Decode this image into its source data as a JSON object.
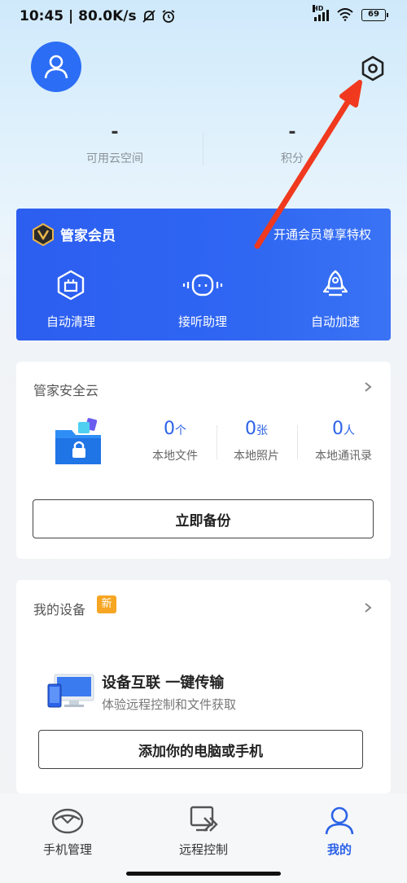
{
  "status_bar": {
    "time_speed": "10:45 | 80.0K/s",
    "network": "HD",
    "battery": "69"
  },
  "header": {
    "stats": [
      {
        "value": "-",
        "label": "可用云空间"
      },
      {
        "value": "-",
        "label": "积分"
      }
    ]
  },
  "vip": {
    "title": "管家会员",
    "promo": "开通会员尊享特权",
    "features": [
      {
        "label": "自动清理",
        "icon": "broom-box-icon"
      },
      {
        "label": "接听助理",
        "icon": "robot-icon"
      },
      {
        "label": "自动加速",
        "icon": "rocket-icon"
      }
    ]
  },
  "security_cloud": {
    "title": "管家安全云",
    "metrics": [
      {
        "value": "0",
        "unit": "个",
        "label": "本地文件"
      },
      {
        "value": "0",
        "unit": "张",
        "label": "本地照片"
      },
      {
        "value": "0",
        "unit": "人",
        "label": "本地通讯录"
      }
    ],
    "button": "立即备份"
  },
  "devices": {
    "title": "我的设备",
    "badge": "新",
    "headline": "设备互联 一键传输",
    "subline": "体验远程控制和文件获取",
    "button": "添加你的电脑或手机"
  },
  "bottom_nav": {
    "items": [
      {
        "label": "手机管理",
        "active": false
      },
      {
        "label": "远程控制",
        "active": false
      },
      {
        "label": "我的",
        "active": true
      }
    ]
  },
  "colors": {
    "accent": "#2b62e8",
    "vip_bg": "#2f66f2",
    "badge": "#f6a623"
  }
}
